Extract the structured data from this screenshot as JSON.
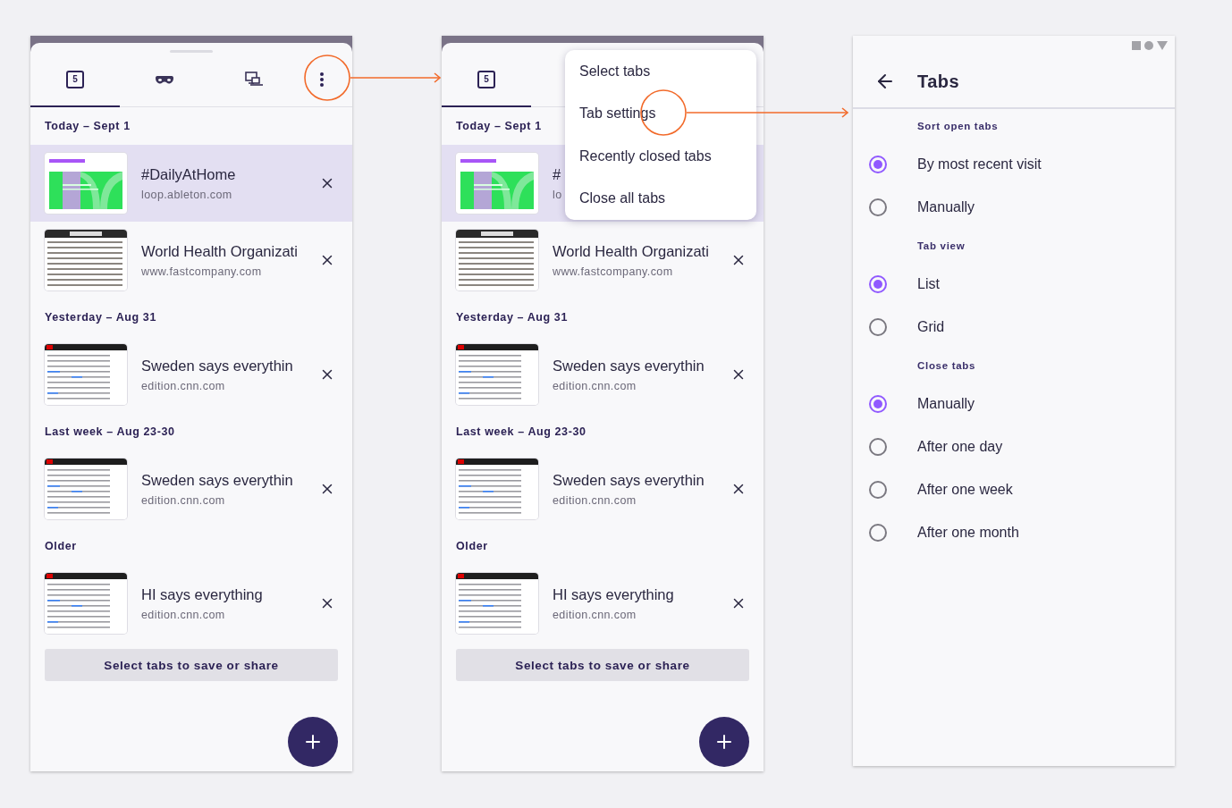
{
  "screens": [
    {
      "kind": "tab_list",
      "tabs": [
        {
          "kind": "counter",
          "label": "5",
          "selected": true
        },
        {
          "kind": "private",
          "selected": false
        },
        {
          "kind": "synced",
          "selected": false
        }
      ],
      "sections": [
        {
          "heading": "Today – Sept 1",
          "items": [
            {
              "title": "#DailyAtHome",
              "url": "loop.ableton.com",
              "kind": "poster",
              "selected": true,
              "closable": true
            },
            {
              "title": "World Health Organizati",
              "url": "www.fastcompany.com",
              "kind": "print",
              "selected": false,
              "closable": true
            }
          ]
        },
        {
          "heading": "Yesterday – Aug 31",
          "items": [
            {
              "title": "Sweden says everythin",
              "url": "edition.cnn.com",
              "kind": "news",
              "selected": false,
              "closable": true
            }
          ]
        },
        {
          "heading": "Last week – Aug 23-30",
          "items": [
            {
              "title": "Sweden says everythin",
              "url": "edition.cnn.com",
              "kind": "news",
              "selected": false,
              "closable": true
            }
          ]
        },
        {
          "heading": "Older",
          "items": [
            {
              "title": "HI says everything",
              "url": "edition.cnn.com",
              "kind": "news",
              "selected": false,
              "closable": true
            }
          ]
        }
      ],
      "action": "Select tabs to save or share"
    },
    {
      "kind": "tab_list",
      "tabs": [
        {
          "kind": "counter",
          "label": "5",
          "selected": true
        }
      ],
      "sections": [
        {
          "heading": "Today – Sept 1",
          "items": [
            {
              "title": "#",
              "url": "lo",
              "kind": "poster",
              "selected": true,
              "closable": false
            },
            {
              "title": "World Health Organizati",
              "url": "www.fastcompany.com",
              "kind": "print",
              "selected": false,
              "closable": true
            }
          ]
        },
        {
          "heading": "Yesterday – Aug 31",
          "items": [
            {
              "title": "Sweden says everythin",
              "url": "edition.cnn.com",
              "kind": "news",
              "selected": false,
              "closable": true
            }
          ]
        },
        {
          "heading": "Last week – Aug 23-30",
          "items": [
            {
              "title": "Sweden says everythin",
              "url": "edition.cnn.com",
              "kind": "news",
              "selected": false,
              "closable": true
            }
          ]
        },
        {
          "heading": "Older",
          "items": [
            {
              "title": "HI says everything",
              "url": "edition.cnn.com",
              "kind": "news",
              "selected": false,
              "closable": true
            }
          ]
        }
      ],
      "action": "Select tabs to save or share",
      "menu": {
        "items": [
          "Select tabs",
          "Tab settings",
          "Recently closed tabs",
          "Close all tabs"
        ]
      }
    },
    {
      "kind": "settings",
      "title": "Tabs",
      "groups": [
        {
          "heading": "Sort open tabs",
          "options": [
            {
              "label": "By most recent visit",
              "selected": true
            },
            {
              "label": "Manually",
              "selected": false
            }
          ]
        },
        {
          "heading": "Tab view",
          "options": [
            {
              "label": "List",
              "selected": true
            },
            {
              "label": "Grid",
              "selected": false
            }
          ]
        },
        {
          "heading": "Close tabs",
          "options": [
            {
              "label": "Manually",
              "selected": true
            },
            {
              "label": "After one day",
              "selected": false
            },
            {
              "label": "After one week",
              "selected": false
            },
            {
              "label": "After one month",
              "selected": false
            }
          ]
        }
      ]
    }
  ]
}
